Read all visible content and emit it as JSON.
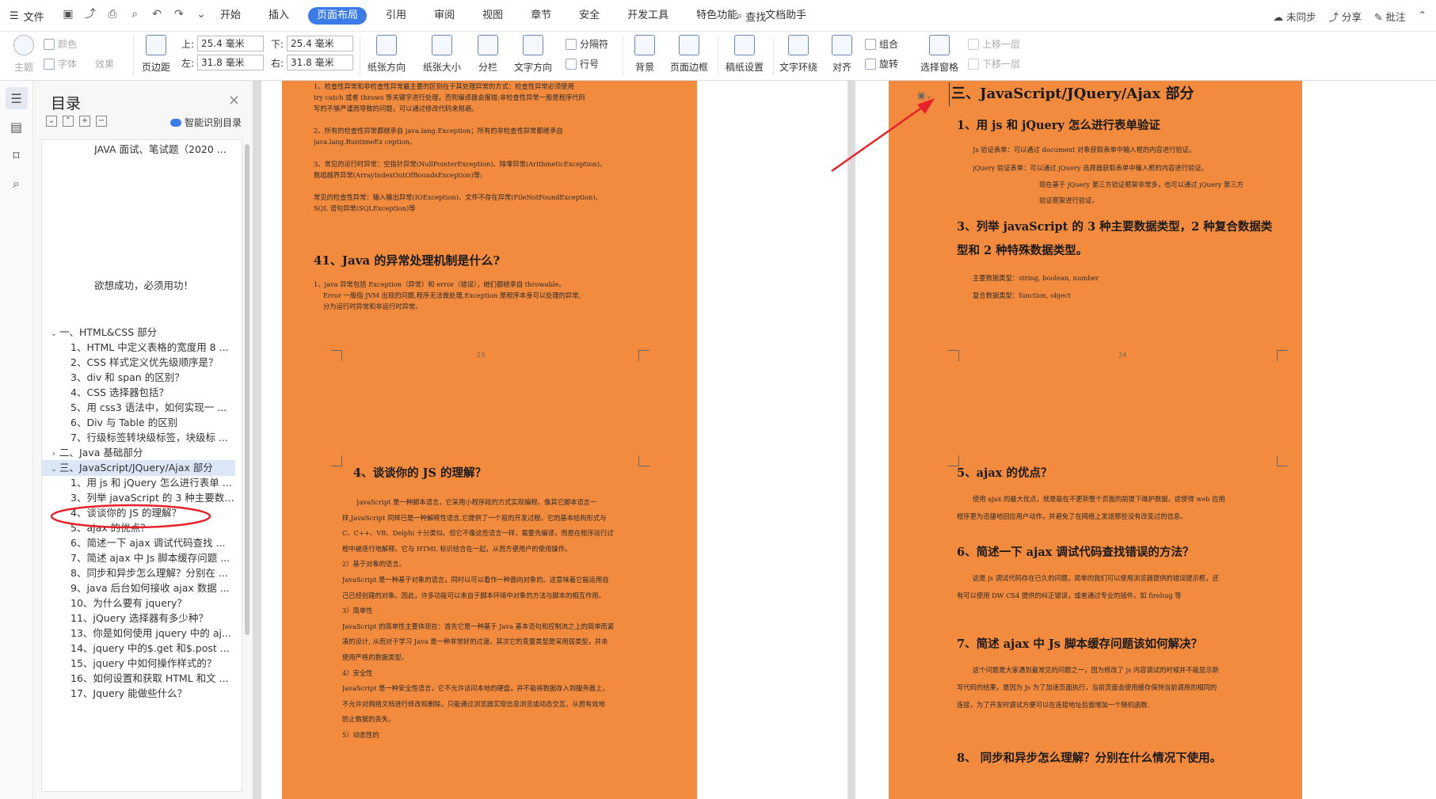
{
  "top": {
    "file": "文件",
    "tabs": [
      "开始",
      "插入",
      "页面布局",
      "引用",
      "审阅",
      "视图",
      "章节",
      "安全",
      "开发工具",
      "特色功能",
      "文档助手"
    ],
    "active_tab": "页面布局",
    "search": "查找",
    "sync": "未同步",
    "share": "分享",
    "batch": "批注"
  },
  "ribbon": {
    "theme": "主题",
    "color": "颜色",
    "font": "字体",
    "effect": "效果",
    "margin": "页边距",
    "top_lbl": "上:",
    "top_val": "25.4 毫米",
    "bottom_lbl": "下:",
    "bottom_val": "25.4 毫米",
    "left_lbl": "左:",
    "left_val": "31.8 毫米",
    "right_lbl": "右:",
    "right_val": "31.8 毫米",
    "orientation": "纸张方向",
    "size": "纸张大小",
    "columns": "分栏",
    "text_dir": "文字方向",
    "break": "分隔符",
    "line_no": "行号",
    "background": "背景",
    "border": "页面边框",
    "draft": "稿纸设置",
    "wrap": "文字环绕",
    "align": "对齐",
    "group": "组合",
    "rotate": "旋转",
    "select_pane": "选择窗格",
    "up": "上移一层",
    "down": "下移一层"
  },
  "toc": {
    "title": "目录",
    "smart": "智能识别目录",
    "items": [
      {
        "text": "JAVA 面试、笔试题（2020 ...",
        "level": 0,
        "tw": ""
      },
      {
        "text": "欲想成功，必须用功！",
        "level": 0,
        "tw": ""
      },
      {
        "text": "一、HTML&CSS 部分",
        "level": 0,
        "tw": "v"
      },
      {
        "text": "1、HTML 中定义表格的宽度用 8 ...",
        "level": 1,
        "tw": ""
      },
      {
        "text": "2、CSS 样式定义优先级顺序是？",
        "level": 1,
        "tw": ""
      },
      {
        "text": "3、div 和 span 的区别？",
        "level": 1,
        "tw": ""
      },
      {
        "text": "4、CSS 选择器包括？",
        "level": 1,
        "tw": ""
      },
      {
        "text": "5、用 css3 语法中，如何实现一 ...",
        "level": 1,
        "tw": ""
      },
      {
        "text": "6、Div 与 Table 的区别",
        "level": 1,
        "tw": ""
      },
      {
        "text": "7、行级标签转块级标签，块级标 ...",
        "level": 1,
        "tw": ""
      },
      {
        "text": "二、Java 基础部分",
        "level": 0,
        "tw": ">"
      },
      {
        "text": "三、JavaScript/JQuery/Ajax 部分",
        "level": 0,
        "tw": "v"
      },
      {
        "text": "1、用 js 和 jQuery 怎么进行表单 ...",
        "level": 1,
        "tw": ""
      },
      {
        "text": "3、列举 javaScript 的 3 种主要数 ...",
        "level": 1,
        "tw": ""
      },
      {
        "text": "4、谈谈你的 JS 的理解？",
        "level": 1,
        "tw": ""
      },
      {
        "text": "5、ajax 的优点？",
        "level": 1,
        "tw": ""
      },
      {
        "text": "6、简述一下 ajax 调试代码查找 ...",
        "level": 1,
        "tw": ""
      },
      {
        "text": "7、简述 ajax 中 Js 脚本缓存问题 ...",
        "level": 1,
        "tw": ""
      },
      {
        "text": "8、同步和异步怎么理解？分别在 ...",
        "level": 1,
        "tw": ""
      },
      {
        "text": "9、java 后台如何接收 ajax 数据 ...",
        "level": 1,
        "tw": ""
      },
      {
        "text": "10、为什么要有 jquery？",
        "level": 1,
        "tw": ""
      },
      {
        "text": "11、jQuery 选择器有多少种？",
        "level": 1,
        "tw": ""
      },
      {
        "text": "13、你是如何使用 jquery 中的 aj...",
        "level": 1,
        "tw": ""
      },
      {
        "text": "14、jquery 中的$.get 和$.post ...",
        "level": 1,
        "tw": ""
      },
      {
        "text": "15、jquery 中如何操作样式的？",
        "level": 1,
        "tw": ""
      },
      {
        "text": "16、如何设置和获取 HTML 和文 ...",
        "level": 1,
        "tw": ""
      },
      {
        "text": "17、Jquery 能做些什么？",
        "level": 1,
        "tw": ""
      }
    ]
  },
  "page23": {
    "lines": [
      "1、检查性异常和非检查性异常最主要的区别在于其处理异常的方式：检查性异常必须使用",
      "try catch 或者 throws 等关键字进行处理，否则编译器会报错;非检查性异常一般是程序代码",
      "写的不够严谨而导致的问题，可以通过修改代码来规避。",
      "2、所有的检查性异常都继承自 java.lang.Exception；所有的非检查性异常都继承自",
      "java.lang.RuntimeEx ception。",
      "3、常见的运行时异常：空指针异常(NullPointerException)、除零异常(ArithmeticException)、",
      "数组越界异常(ArrayIndexOutOfBoundsException)等;",
      "常见的检查性异常：输入输出异常(IOException)、文件不存在异常(FileNotFoundException)、",
      "SQL 语句异常(SQLException)等"
    ],
    "h41": "41、Java 的异常处理机制是什么?",
    "l41a": "1、java 异常包括 Exception（异常）和 error（错误），她们都继承自 throwable。",
    "l41b": "Error 一般指 JVM 出现的问题,程序无法做处理,Exception 是程序本身可以处理的异常,",
    "l41c": "分为运行时异常和非运行时异常。",
    "num": "23"
  },
  "page24": {
    "h3": "三、JavaScript/JQuery/Ajax 部分",
    "h1": "1、用 js 和 jQuery 怎么进行表单验证",
    "l1": "Js 验证表单：可以通过 document 对象获取表单中输入框的内容进行验证。",
    "l2": "jQuery 验证表单：可以通过 jQuery 选择器获取表单中输入框的内容进行验证。",
    "l3": "现在基于 jQuery 第三方验证框架非常多，也可以通过 jQuery 第三方",
    "l4": "验证框架进行验证。",
    "h3a": "3、列举 javaScript 的 3 种主要数据类型，2 种复合数据类",
    "h3b": "型和 2 种特殊数据类型。",
    "t1": "主要数据类型：string, boolean, number",
    "t2": "复合数据类型：function, object",
    "num": "24"
  },
  "page25": {
    "h4": "4、谈谈你的 JS 的理解？",
    "lines": [
      "JavaScript 是一种脚本语言，它采用小程序段的方式实现编程。像其它脚本语言一",
      "样,JavaScript 同样已是一种解释性语言,它提供了一个易的开发过程。它的基本结构形式与",
      "C、C++、VB、Delphi 十分类似。但它不像这些语言一样，需要先编译，而是在程序运行过",
      "程中被逐行地解释。它与 HTML 标识结合在一起，从而方便用户的使用操作。",
      "2）基于对象的语言。",
      "JavaScript 是一种基于对象的语言，同时以可以看作一种面向对象的。这意味着它能运用自",
      "己已经创建的对象。因此，许多功能可以来自于脚本环境中对象的方法与脚本的相互作用。",
      "3）简单性",
      "JavaScript 的简单性主要体现在：首先它是一种基于 Java 基本语句和控制流之上的简单而紧",
      "凑的设计, 从而对于学习 Java 是一种非常好的过渡。其次它的变量类型是采用弱类型，并未",
      "使用严格的数据类型。",
      "4）安全性",
      "JavaScript 是一种安全性语言，它不允许访问本地的硬盘，并不能将数据存入到服务器上，",
      "不允许对网络文档进行修改和删除，只能通过浏览器实现信息浏览或动态交互。从而有效地",
      "防止数据的丢失。",
      "5）动态性的"
    ]
  },
  "page26": {
    "h5": "5、ajax 的优点？",
    "p5a": "使用 ajax 的最大优点，就是能在不更新整个页面的前提下维护数据。这使得 web 应用",
    "p5b": "程序更为迅捷地回应用户动作，并避免了在网络上发送那些没有改变过的信息。",
    "h6": "6、简述一下 ajax 调试代码查找错误的方法？",
    "p6a": "这是 js 调试代码存在已久的问题，简单的我们可以使用浏览器提供的错误提示框，还",
    "p6b": "有可以使用 DW CS4 提供的纠正错误，或者通过专业的插件，如 firebug 等",
    "h7": "7、简述 ajax 中 Js 脚本缓存问题该如何解决？",
    "p7a": "这个问题是大家遇到最常见的问题之一，因为修改了 js 内容调试的时候并不能显示新",
    "p7b": "写代码的结果，是因为 Js 为了加速页面执行，当前页面会使用缓存保持当前调用的相同的",
    "p7c": "连接，为了开发时调试方便可以在连接地址后面增加一个随机函数.",
    "h8": "8、 同步和异步怎么理解？分别在什么情况下使用。"
  },
  "colors": {
    "accent": "#3b7be8",
    "page_orange": "#f38b3e",
    "arrow": "#e8222a"
  }
}
